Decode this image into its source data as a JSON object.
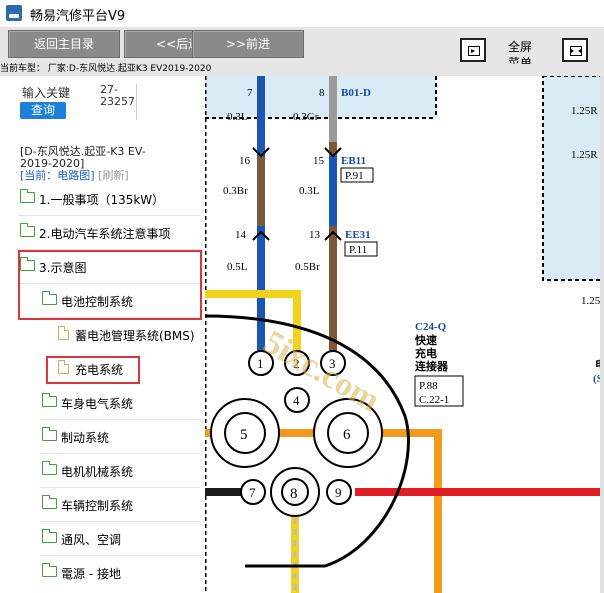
{
  "app": {
    "title": "畅易汽修平台V9"
  },
  "toolbar": {
    "back_main": "返回主目录",
    "back": "<<后退.",
    "forward": ">>前进",
    "expand_label": "全屏",
    "menu_label": "菜单"
  },
  "info": "当前车型：  厂家:D-东风悦达.起亚K3 EV2019-2020",
  "search": {
    "label": "输入关键",
    "value_line1": "27-",
    "value_line2": "23257",
    "button": "查询"
  },
  "vehicle": {
    "line1": "[D-东风悦达.起亚-K3 EV-",
    "line2": "2019-2020]",
    "bc_current": "[当前：电路图]",
    "bc_refresh": "[刷新]"
  },
  "tree": [
    {
      "label": "1.一般事项（135kW）"
    },
    {
      "label": "2.电动汽车系统注意事项"
    },
    {
      "label": "3.示意图"
    },
    {
      "label": "电池控制系统"
    },
    {
      "label": "蓄电池管理系统(BMS)"
    },
    {
      "label": "充电系统"
    },
    {
      "label": "车身电气系统"
    },
    {
      "label": "制动系统"
    },
    {
      "label": "电机机械系统"
    },
    {
      "label": "车辆控制系统"
    },
    {
      "label": "通风、空调"
    },
    {
      "label": "電源 - 接地"
    }
  ],
  "diagram": {
    "pin_top": [
      "7",
      "8",
      "16",
      "15",
      "14",
      "13"
    ],
    "wire_specs": [
      "0.3L",
      "0.3Gr",
      "0.3Br",
      "0.3L",
      "0.5L",
      "0.5Br"
    ],
    "conn_b01": "B01-D",
    "conn_eb11": "EB11",
    "ref_p91": "P.91",
    "conn_ee31": "EE31",
    "ref_p11": "P.11",
    "conn_c24": "C24-Q",
    "c24_desc1": "快速",
    "c24_desc2": "充电",
    "c24_desc3": "连接器",
    "ref_p88": "P.88",
    "ref_c22": "C.22-1",
    "pins": [
      "1",
      "2",
      "3",
      "4",
      "5",
      "6",
      "7",
      "8",
      "9"
    ],
    "right_125a": "1.25R",
    "right_125b": "1.25R",
    "right_125c": "1.25",
    "right_dian": "电",
    "right_s": "(S",
    "watermark": "5ixc.com"
  },
  "colors": {
    "toolbar_btn": "#8a8a8a",
    "query_btn": "#1e7fd8",
    "highlight": "#d9363e",
    "folder": "#3aa634",
    "doc": "#e8a44a"
  }
}
